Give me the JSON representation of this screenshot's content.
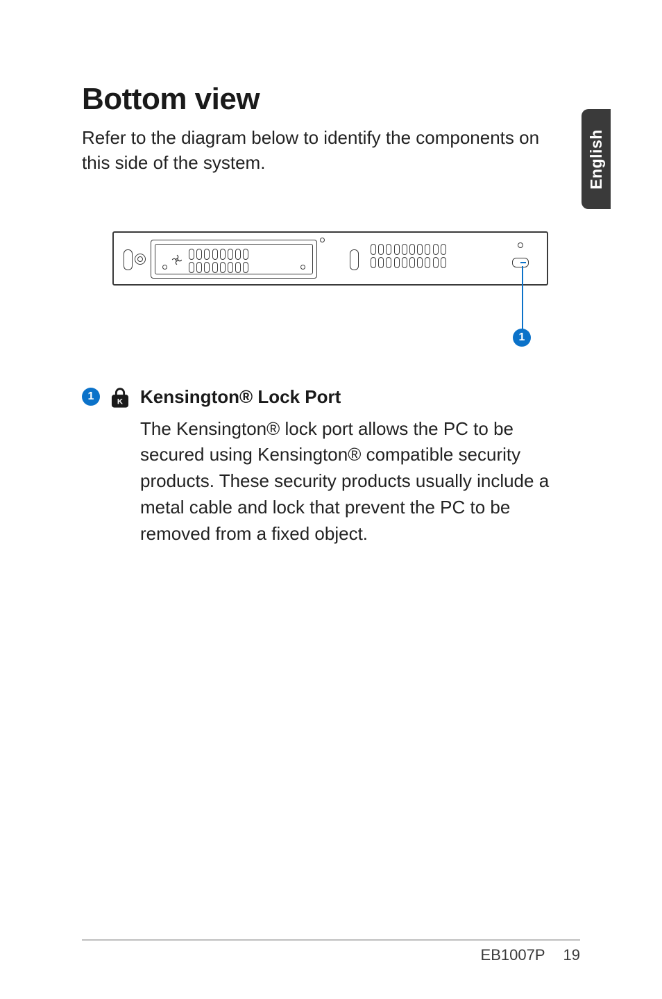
{
  "sideTab": {
    "language": "English"
  },
  "heading": "Bottom view",
  "intro": "Refer to the diagram below to identify the components on this side of the system.",
  "callout": {
    "number": "1"
  },
  "legend": {
    "number": "1",
    "title": "Kensington® Lock Port",
    "text": "The Kensington® lock port allows the PC to be secured using Kensington® compatible security products. These security products usually include a metal cable and lock that prevent the PC to be removed from a fixed object."
  },
  "footer": {
    "model": "EB1007P",
    "page": "19"
  }
}
